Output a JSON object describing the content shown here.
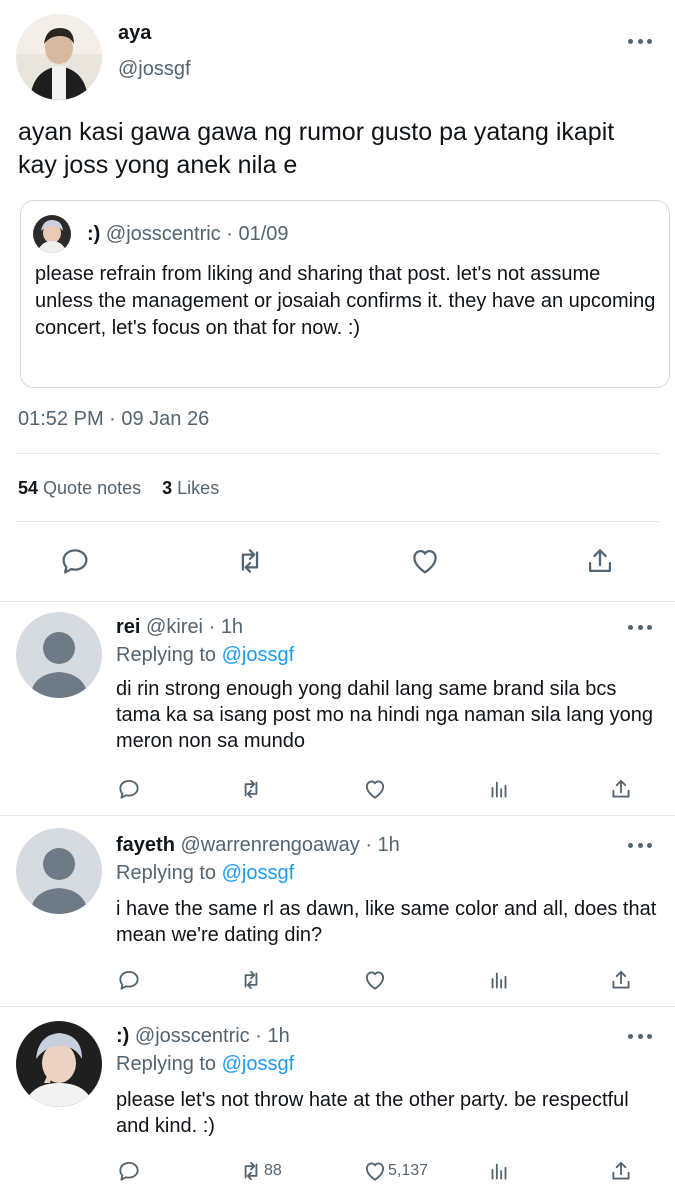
{
  "main_tweet": {
    "author_name": "aya",
    "author_handle": "@jossgf",
    "text": "ayan kasi gawa gawa ng rumor gusto pa yatang ikapit kay joss yong anek nila e",
    "quote": {
      "name": ":)",
      "handle": "@josscentric",
      "sep": "·",
      "date": "01/09",
      "text": "please refrain from liking and sharing that post. let's not assume unless the management or josaiah confirms it. they have an upcoming concert, let's focus on that for now. :)"
    },
    "timestamp": "01:52 PM · 09 Jan 26",
    "stats": {
      "quote_count": "54",
      "quote_label": "Quote notes",
      "like_count": "3",
      "like_label": "Likes"
    },
    "actions": [
      "reply-icon",
      "retweet-icon",
      "like-icon",
      "share-icon"
    ]
  },
  "replies": [
    {
      "name": "rei",
      "handle": "@kirei",
      "sep": "·",
      "time": "1h",
      "replying_prefix": "Replying to",
      "replying_to": "@jossgf",
      "text": "di rin strong enough yong dahil lang same brand sila bcs tama ka sa isang post mo na hindi nga naman sila lang yong meron non sa mundo",
      "retweets": "",
      "likes": ""
    },
    {
      "name": "fayeth",
      "handle": "@warrenrengoaway",
      "sep": "·",
      "time": "1h",
      "replying_prefix": "Replying to",
      "replying_to": "@jossgf",
      "text": "i have the same rl as dawn, like same color and all, does that mean we're dating din?",
      "retweets": "",
      "likes": ""
    },
    {
      "name": ":)",
      "handle": "@josscentric",
      "sep": "·",
      "time": "1h",
      "replying_prefix": "Replying to",
      "replying_to": "@jossgf",
      "text": "please let's not throw hate at the other party. be respectful and kind. :)",
      "retweets": "88",
      "likes": "5,137"
    }
  ],
  "colors": {
    "link": "#1d9bf0",
    "muted": "#536471",
    "text": "#0f1419",
    "border": "#cfd9de"
  }
}
